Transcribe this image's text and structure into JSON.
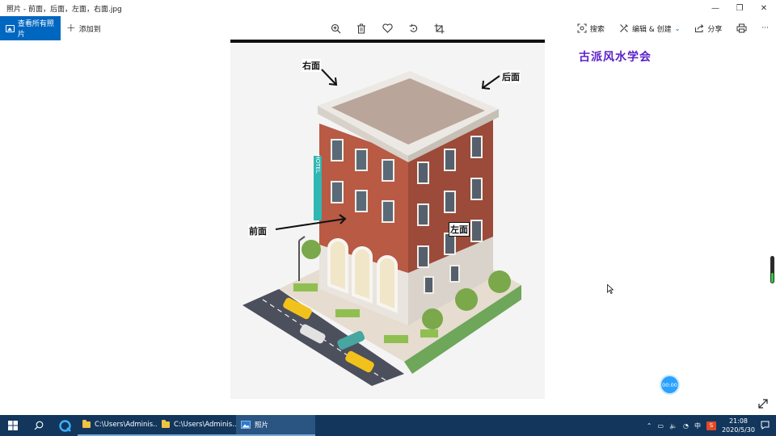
{
  "window": {
    "title": "照片 - 前面，后面，左面，右面.jpg",
    "minimize_glyph": "—",
    "restore_glyph": "❐",
    "close_glyph": "✕"
  },
  "toolbar": {
    "see_all_label": "查看所有照片",
    "add_to_label": "添加到",
    "search_label": "搜索",
    "edit_create_label": "编辑 & 创建",
    "share_label": "分享",
    "more_label": "···"
  },
  "photo": {
    "labels": {
      "right_face": "右面",
      "back_face": "后面",
      "front_face": "前面",
      "left_face": "左面"
    },
    "society_text": "古派风水学会",
    "sign_text": "HOTEL"
  },
  "overlay": {
    "timer": "00:00"
  },
  "taskbar": {
    "apps": [
      {
        "label": "C:\\Users\\Adminis..."
      },
      {
        "label": "C:\\Users\\Adminis..."
      },
      {
        "label": "照片"
      }
    ],
    "tray": {
      "ime_label": "中",
      "ime_badge": "S",
      "time": "21:08",
      "date": "2020/5/30"
    }
  },
  "colors": {
    "accent": "#0067c0",
    "taskbar": "#12365c",
    "society_text": "#5a1fc9",
    "timer": "#2aa1ff"
  }
}
